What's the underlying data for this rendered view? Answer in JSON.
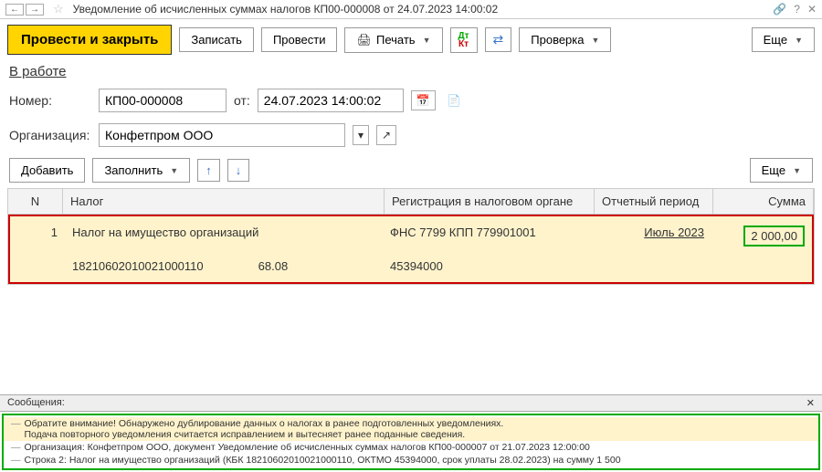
{
  "titlebar": {
    "title": "Уведомление об исчисленных суммах налогов КП00-000008 от 24.07.2023 14:00:02"
  },
  "toolbar": {
    "post_close": "Провести и закрыть",
    "write": "Записать",
    "post": "Провести",
    "print": "Печать",
    "check": "Проверка",
    "more": "Еще"
  },
  "status": {
    "label": "В работе"
  },
  "form": {
    "number_label": "Номер:",
    "number": "КП00-000008",
    "from_label": "от:",
    "date": "24.07.2023 14:00:02",
    "org_label": "Организация:",
    "org": "Конфетпром ООО"
  },
  "table_tb": {
    "add": "Добавить",
    "fill": "Заполнить",
    "more": "Еще"
  },
  "table": {
    "headers": {
      "n": "N",
      "tax": "Налог",
      "reg": "Регистрация в налоговом органе",
      "period": "Отчетный период",
      "sum": "Сумма"
    },
    "row": {
      "n": "1",
      "tax_name": "Налог на имущество организаций",
      "tax_kbk": "18210602010021000110",
      "tax_code2": "68.08",
      "reg": "ФНС 7799 КПП 779901001",
      "oktmo": "45394000",
      "period": "Июль 2023",
      "sum": "2 000,00"
    }
  },
  "messages": {
    "header": "Сообщения:",
    "warn1": "Обратите внимание! Обнаружено дублирование данных о налогах в ранее подготовленных уведомлениях.",
    "warn2": "Подача повторного уведомления считается исправлением и вытесняет ранее поданные сведения.",
    "line2": "Организация: Конфетпром ООО, документ Уведомление об исчисленных суммах налогов КП00-000007 от 21.07.2023 12:00:00",
    "line3": "Строка 2: Налог на имущество организаций (КБК 18210602010021000110, ОКТМО 45394000, срок уплаты 28.02.2023) на сумму 1 500"
  }
}
